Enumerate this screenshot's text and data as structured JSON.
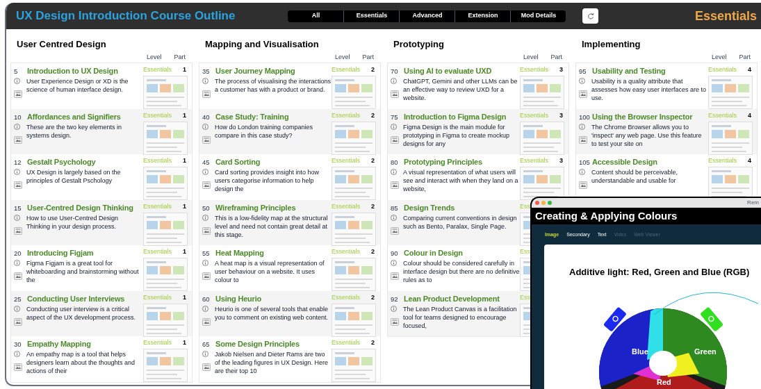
{
  "header": {
    "title": "UX Design Introduction Course Outline",
    "filters": [
      "All",
      "Essentials",
      "Advanced",
      "Extension",
      "Mod Details"
    ],
    "current_filter": "Essentials"
  },
  "columns": [
    {
      "title": "User Centred Design",
      "level_heading": "Level",
      "part_heading": "Part",
      "rows": [
        {
          "number": "5",
          "title": "Introduction to UX Design",
          "level": "Essentials",
          "part": "1",
          "description": "User Experience Design or XD is the science of human interface design."
        },
        {
          "number": "10",
          "title": "Affordances and Signifiers",
          "level": "Essentials",
          "part": "1",
          "description": "These are the two key elements in systems design."
        },
        {
          "number": "12",
          "title": "Gestalt Psychology",
          "level": "Essentials",
          "part": "1",
          "description": "UX Design is largely based on the principles of Gestalt Pschology"
        },
        {
          "number": "15",
          "title": "User-Centred Design Thinking",
          "level": "Essentials",
          "part": "1",
          "description": "How to use User-Centred Design Thinking in your design process."
        },
        {
          "number": "20",
          "title": "Introducing Figjam",
          "level": "Essentials",
          "part": "1",
          "description": "Figma Figjam is a great tool for whiteboarding and brainstorming without the"
        },
        {
          "number": "25",
          "title": "Conducting User Interviews",
          "level": "Essentials",
          "part": "1",
          "description": "Conducting user interview is a critical aspect of the UX development process."
        },
        {
          "number": "30",
          "title": "Empathy Mapping",
          "level": "Essentials",
          "part": "1",
          "description": "An empathy map is a tool that helps designers learn about the thoughts and actions of their"
        }
      ]
    },
    {
      "title": "Mapping and Visualisation",
      "level_heading": "Level",
      "part_heading": "Part",
      "rows": [
        {
          "number": "35",
          "title": "User Journey Mapping",
          "level": "Essentials",
          "part": "2",
          "description": "The process of visualising the interactions a customer has with a product or brand."
        },
        {
          "number": "40",
          "title": "Case Study: Training",
          "level": "Essentials",
          "part": "2",
          "description": "How do London training companies compare in this case study?"
        },
        {
          "number": "45",
          "title": "Card Sorting",
          "level": "Essentials",
          "part": "2",
          "description": "Card sorting provides insight into how users categorise information to help design the"
        },
        {
          "number": "50",
          "title": "Wireframing Principles",
          "level": "Essentials",
          "part": "2",
          "description": "This is a low-fidelity map at the structural level and need not contain great detail at this stage."
        },
        {
          "number": "55",
          "title": "Heat Mapping",
          "level": "Essentials",
          "part": "2",
          "description": "A heat map is a visual representation of user behaviour on a website. It uses colour to"
        },
        {
          "number": "60",
          "title": "Using Heurio",
          "level": "Essentials",
          "part": "2",
          "description": "Heurio is one of several tools that enable you to comment on existing web content."
        },
        {
          "number": "65",
          "title": "Some Design Principles",
          "level": "Essentials",
          "part": "2",
          "description": "Jakob Nielsen and Dieter Rams are two of the leading figures in UX Design. Here are their top 10"
        }
      ]
    },
    {
      "title": "Prototyping",
      "level_heading": "Level",
      "part_heading": "Part",
      "rows": [
        {
          "number": "70",
          "title": "Using AI to evaluate UXD",
          "level": "Essentials",
          "part": "3",
          "description": "ChatGPT, Gemini and other LLMs can be an effective way to review UXD for a website."
        },
        {
          "number": "75",
          "title": "Introduction to Figma Design",
          "level": "Essentials",
          "part": "3",
          "description": "Figma Design is the main module for prototyping in Figma to create mockup designs for any"
        },
        {
          "number": "80",
          "title": "Prototyping Principles",
          "level": "Essentials",
          "part": "3",
          "description": "A visual representation of what users will see and interact with when they land on a website,"
        },
        {
          "number": "85",
          "title": "Design Trends",
          "level": "Ess",
          "description": "Comparing current conventions in design such as Bento, Paralax, Single Page."
        },
        {
          "number": "90",
          "title": "Colour in Design",
          "level": "Ess",
          "description": "Colour should be considered carefully in interface design but there are no definitive rules as to"
        },
        {
          "number": "92",
          "title": "Lean Product Development",
          "level": "Ess",
          "description": "The Lean Product Canvas is a facilitation tool for teams designed to encourage focused,"
        }
      ]
    },
    {
      "title": "Implementing",
      "level_heading": "Level",
      "part_heading": "Part",
      "rows": [
        {
          "number": "95",
          "title": "Usability and Testing",
          "level": "Essentials",
          "part": "4",
          "description": "Usability is a quality attribute that assesses how easy user interfaces are to use."
        },
        {
          "number": "100",
          "title": "Using the Browser Inspector",
          "level": "Essentials",
          "part": "4",
          "description": "The Chrome Browser allows you to 'inspect' any web page. Use this feature to test your site on"
        },
        {
          "number": "105",
          "title": "Accessible Design",
          "level": "Essentials",
          "part": "4",
          "description": "Content should be perceivable, understandable and usable for"
        }
      ]
    }
  ],
  "popup": {
    "window_label": "Rem",
    "title": "Creating & Applying Colours",
    "tabs": [
      {
        "label": "Image",
        "selected": true,
        "disabled": false
      },
      {
        "label": "Secondary",
        "selected": false,
        "disabled": false
      },
      {
        "label": "Text",
        "selected": false,
        "disabled": false
      },
      {
        "label": "Video",
        "selected": false,
        "disabled": true
      },
      {
        "label": "Web Viewer",
        "selected": false,
        "disabled": true
      }
    ],
    "slide": {
      "heading": "Additive light: Red, Green and Blue (RGB)",
      "labels": [
        "Blue",
        "Green",
        "Red"
      ]
    }
  }
}
